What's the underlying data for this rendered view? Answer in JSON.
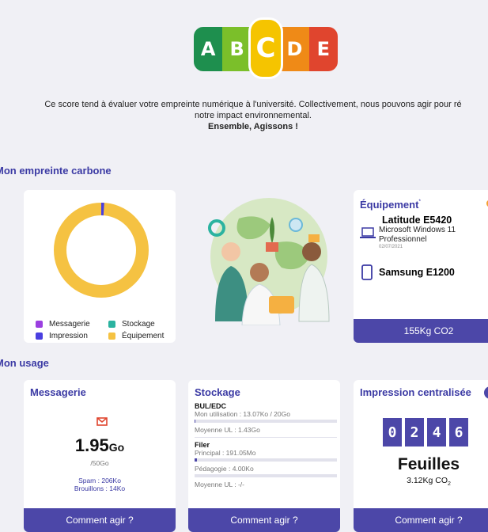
{
  "score": {
    "letters": [
      "A",
      "B",
      "C",
      "D",
      "E"
    ],
    "colors": [
      "#1e8f4e",
      "#7bbf2a",
      "#f5c400",
      "#ef8a17",
      "#e0452e"
    ],
    "active": "C",
    "active_color": "#f5c400"
  },
  "intro": {
    "line1": "Ce score tend à évaluer votre empreinte numérique à l'université. Collectivement, nous pouvons agir pour ré",
    "line2": "notre impact environnemental.",
    "line3": "Ensemble, Agissons !"
  },
  "sections": {
    "carbon_title": "Mon empreinte carbone",
    "usage_title": "Mon usage"
  },
  "carbon": {
    "legend": [
      {
        "label": "Messagerie",
        "color": "#9b3fe0"
      },
      {
        "label": "Stockage",
        "color": "#2bb3a0"
      },
      {
        "label": "Impression",
        "color": "#4a3fe0"
      },
      {
        "label": "Équipement",
        "color": "#f5c242"
      }
    ],
    "donut_color": "#f5c242",
    "donut_accent_color": "#4a3fe0"
  },
  "equipment": {
    "title": "Équipement",
    "title_mark": "*",
    "devices": [
      {
        "icon": "laptop-icon",
        "name": "Latitude E5420",
        "line1": "Microsoft Windows 11",
        "line2": "Professionnel",
        "date": "02/07/2021"
      },
      {
        "icon": "phone-icon",
        "name": "Samsung E1200"
      }
    ],
    "footer": "155Kg CO2"
  },
  "messagerie": {
    "title": "Messagerie",
    "value": "1.95",
    "unit": "Go",
    "quota": "/50Go",
    "spam": "Spam : 206Ko",
    "drafts": "Brouillons : 14Ko",
    "footer": "Comment agir ?",
    "icon": "mail-icon"
  },
  "stockage": {
    "title": "Stockage",
    "bul_title": "BUL/EDC",
    "bul_usage": "Mon utilisation : 13.07Ko / 20Go",
    "bul_avg": "Moyenne UL : 1.43Go",
    "filer_title": "Filer",
    "filer_principal": "Principal : 191.05Mo",
    "filer_pedago": "Pédagogie : 4.00Ko",
    "filer_avg": "Moyenne UL : -/-",
    "footer": "Comment agir ?"
  },
  "impression": {
    "title": "Impression centralisée",
    "digits": [
      "0",
      "2",
      "4",
      "6"
    ],
    "label": "Feuilles",
    "co2_main": "3.12Kg CO",
    "co2_sub": "2",
    "footer": "Comment agir ?"
  }
}
